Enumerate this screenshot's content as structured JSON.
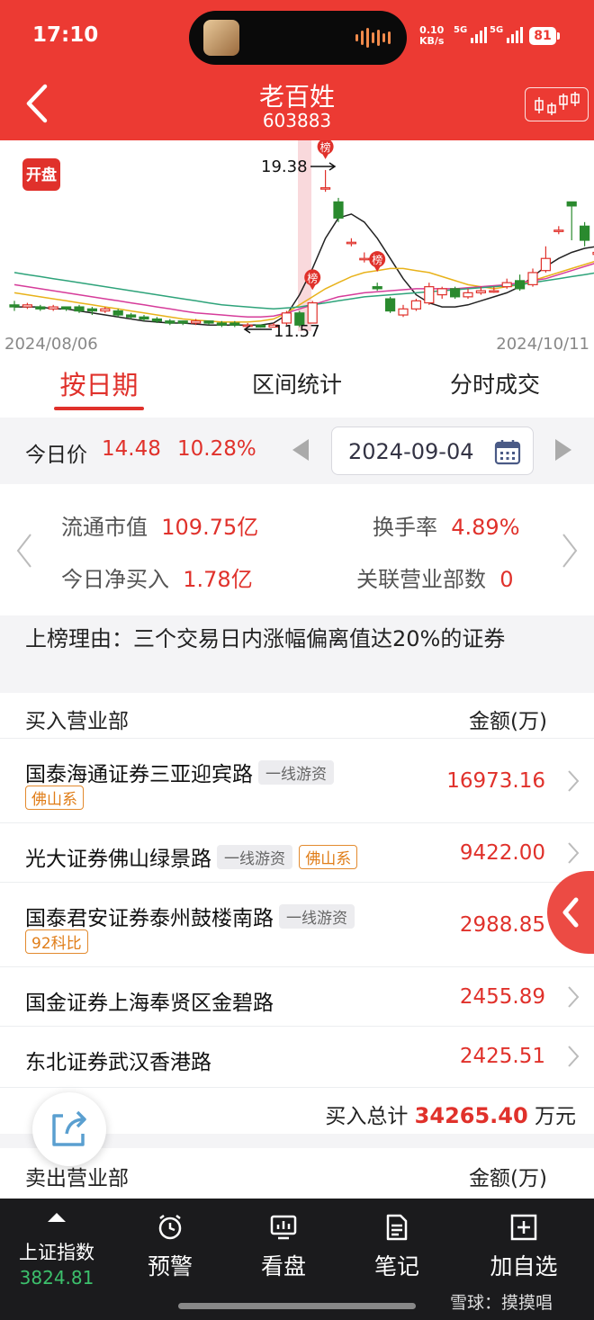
{
  "status_bar": {
    "time": "17:10",
    "net_speed_value": "0.10",
    "net_speed_unit": "KB/s",
    "signal1_label": "5G",
    "signal2_label": "5G",
    "battery": "81"
  },
  "header": {
    "stock_name": "老百姓",
    "stock_code": "603883",
    "back_icon": "chevron-left-icon",
    "kline_icon": "candlestick-icon"
  },
  "chart": {
    "badge_open": "开盘",
    "high_label": "19.38",
    "low_label": "11.57",
    "start_date": "2024/08/06",
    "end_date": "2024/10/11",
    "marker_text": "榜"
  },
  "chart_data": {
    "type": "candlestick",
    "x_start": "2024/08/06",
    "x_end": "2024/10/11",
    "high_marked": 19.38,
    "low_marked": 11.57,
    "candles": [
      {
        "o": 12.7,
        "c": 12.6,
        "h": 12.9,
        "l": 12.4
      },
      {
        "o": 12.6,
        "c": 12.7,
        "h": 12.8,
        "l": 12.5
      },
      {
        "o": 12.6,
        "c": 12.5,
        "h": 12.7,
        "l": 12.4
      },
      {
        "o": 12.5,
        "c": 12.6,
        "h": 12.7,
        "l": 12.4
      },
      {
        "o": 12.6,
        "c": 12.5,
        "h": 12.6,
        "l": 12.4
      },
      {
        "o": 12.6,
        "c": 12.4,
        "h": 12.7,
        "l": 12.3
      },
      {
        "o": 12.5,
        "c": 12.4,
        "h": 12.6,
        "l": 12.2
      },
      {
        "o": 12.4,
        "c": 12.5,
        "h": 12.6,
        "l": 12.3
      },
      {
        "o": 12.4,
        "c": 12.2,
        "h": 12.5,
        "l": 12.1
      },
      {
        "o": 12.2,
        "c": 12.1,
        "h": 12.3,
        "l": 12.0
      },
      {
        "o": 12.1,
        "c": 12.0,
        "h": 12.2,
        "l": 11.9
      },
      {
        "o": 12.0,
        "c": 11.9,
        "h": 12.1,
        "l": 11.8
      },
      {
        "o": 11.9,
        "c": 11.8,
        "h": 12.0,
        "l": 11.7
      },
      {
        "o": 11.9,
        "c": 11.8,
        "h": 11.9,
        "l": 11.7
      },
      {
        "o": 11.8,
        "c": 11.9,
        "h": 12.0,
        "l": 11.7
      },
      {
        "o": 11.9,
        "c": 11.8,
        "h": 11.9,
        "l": 11.7
      },
      {
        "o": 11.8,
        "c": 11.7,
        "h": 11.9,
        "l": 11.6
      },
      {
        "o": 11.8,
        "c": 11.7,
        "h": 11.9,
        "l": 11.6
      },
      {
        "o": 11.7,
        "c": 11.7,
        "h": 11.8,
        "l": 11.6
      },
      {
        "o": 11.7,
        "c": 11.6,
        "h": 11.7,
        "l": 11.57
      },
      {
        "o": 11.6,
        "c": 11.7,
        "h": 11.8,
        "l": 11.6
      },
      {
        "o": 11.8,
        "c": 12.3,
        "h": 12.4,
        "l": 11.7
      },
      {
        "o": 12.3,
        "c": 11.7,
        "h": 12.4,
        "l": 11.6
      },
      {
        "o": 11.8,
        "c": 12.8,
        "h": 12.9,
        "l": 11.8
      },
      {
        "o": 18.5,
        "c": 18.5,
        "h": 19.38,
        "l": 18.3
      },
      {
        "o": 17.8,
        "c": 17.0,
        "h": 18.0,
        "l": 16.8
      },
      {
        "o": 15.8,
        "c": 15.8,
        "h": 16.0,
        "l": 15.6
      },
      {
        "o": 15.0,
        "c": 15.0,
        "h": 15.3,
        "l": 14.8
      },
      {
        "o": 13.6,
        "c": 13.5,
        "h": 13.8,
        "l": 13.4
      },
      {
        "o": 13.0,
        "c": 12.4,
        "h": 13.1,
        "l": 12.3
      },
      {
        "o": 12.2,
        "c": 12.5,
        "h": 12.7,
        "l": 12.1
      },
      {
        "o": 12.5,
        "c": 12.9,
        "h": 13.0,
        "l": 12.4
      },
      {
        "o": 12.8,
        "c": 13.6,
        "h": 13.8,
        "l": 12.7
      },
      {
        "o": 13.2,
        "c": 13.5,
        "h": 13.6,
        "l": 13.0
      },
      {
        "o": 13.5,
        "c": 13.1,
        "h": 13.6,
        "l": 13.0
      },
      {
        "o": 13.1,
        "c": 13.3,
        "h": 13.5,
        "l": 13.0
      },
      {
        "o": 13.3,
        "c": 13.4,
        "h": 13.6,
        "l": 13.2
      },
      {
        "o": 13.4,
        "c": 13.4,
        "h": 13.6,
        "l": 13.3
      },
      {
        "o": 13.6,
        "c": 13.8,
        "h": 14.0,
        "l": 13.5
      },
      {
        "o": 13.9,
        "c": 13.5,
        "h": 14.2,
        "l": 13.4
      },
      {
        "o": 13.7,
        "c": 14.3,
        "h": 14.5,
        "l": 13.6
      },
      {
        "o": 14.4,
        "c": 15.0,
        "h": 15.6,
        "l": 14.3
      },
      {
        "o": 16.4,
        "c": 16.4,
        "h": 16.6,
        "l": 16.2
      },
      {
        "o": 17.8,
        "c": 17.6,
        "h": 17.8,
        "l": 15.9
      },
      {
        "o": 16.6,
        "c": 15.9,
        "h": 16.8,
        "l": 15.6
      },
      {
        "o": 15.2,
        "c": 15.3,
        "h": 15.5,
        "l": 14.8
      },
      {
        "o": 15.3,
        "c": 15.6,
        "h": 15.9,
        "l": 15.1
      }
    ],
    "series": [
      {
        "values": [
          12.6,
          12.6,
          12.6,
          12.5,
          12.5,
          12.4,
          12.3,
          12.2,
          12.1,
          12.0,
          11.9,
          11.85,
          11.8,
          11.8,
          11.75,
          11.7,
          11.7,
          11.7,
          11.7,
          11.7,
          11.8,
          12.2,
          13.2,
          14.5,
          16.0,
          17.0,
          17.2,
          16.8,
          16.0,
          15.0,
          14.0,
          13.2,
          12.8,
          12.6,
          12.6,
          12.7,
          12.9,
          13.1,
          13.3,
          13.6,
          14.1,
          14.6,
          15.0,
          15.3,
          15.5,
          15.6,
          15.7
        ],
        "color": "#222222"
      },
      {
        "values": [
          13.3,
          13.2,
          13.1,
          13.0,
          12.9,
          12.8,
          12.7,
          12.6,
          12.5,
          12.4,
          12.3,
          12.2,
          12.1,
          12.0,
          11.95,
          11.9,
          11.85,
          11.85,
          11.85,
          11.9,
          12.0,
          12.3,
          12.7,
          13.1,
          13.5,
          13.8,
          14.1,
          14.3,
          14.4,
          14.5,
          14.5,
          14.4,
          14.3,
          14.1,
          13.9,
          13.7,
          13.6,
          13.5,
          13.6,
          13.7,
          13.9,
          14.1,
          14.3,
          14.5,
          14.7,
          14.9,
          15.0
        ],
        "color": "#e8b21a"
      },
      {
        "values": [
          13.7,
          13.6,
          13.5,
          13.4,
          13.3,
          13.2,
          13.1,
          13.0,
          12.9,
          12.8,
          12.7,
          12.6,
          12.5,
          12.4,
          12.3,
          12.25,
          12.2,
          12.15,
          12.1,
          12.1,
          12.15,
          12.3,
          12.5,
          12.7,
          12.9,
          13.1,
          13.2,
          13.3,
          13.35,
          13.4,
          13.45,
          13.5,
          13.5,
          13.5,
          13.5,
          13.55,
          13.6,
          13.65,
          13.7,
          13.8,
          13.9,
          14.0,
          14.2,
          14.4,
          14.6,
          14.8,
          15.0
        ],
        "color": "#d63c9a"
      },
      {
        "values": [
          14.3,
          14.2,
          14.1,
          14.0,
          13.9,
          13.8,
          13.7,
          13.6,
          13.5,
          13.4,
          13.3,
          13.2,
          13.1,
          13.0,
          12.9,
          12.8,
          12.7,
          12.65,
          12.6,
          12.55,
          12.5,
          12.55,
          12.6,
          12.7,
          12.8,
          12.9,
          13.0,
          13.1,
          13.15,
          13.2,
          13.25,
          13.3,
          13.35,
          13.4,
          13.45,
          13.5,
          13.55,
          13.6,
          13.65,
          13.7,
          13.8,
          13.9,
          14.0,
          14.1,
          14.2,
          14.3,
          14.4
        ],
        "color": "#2ea37a"
      }
    ],
    "up_color": "#e0312b",
    "down_color": "#2a8a2e",
    "markers": [
      {
        "index": 23,
        "text": "榜"
      },
      {
        "index": 24,
        "text": "榜"
      },
      {
        "index": 28,
        "text": "榜"
      }
    ]
  },
  "tabs": [
    "按日期",
    "区间统计",
    "分时成交"
  ],
  "date_row": {
    "price_label": "今日价",
    "price": "14.48",
    "change_pct": "10.28%",
    "date": "2024-09-04"
  },
  "stats": {
    "float_cap_label": "流通市值",
    "float_cap_value": "109.75亿",
    "turnover_label": "换手率",
    "turnover_value": "4.89%",
    "net_buy_label": "今日净买入",
    "net_buy_value": "1.78亿",
    "branches_label": "关联营业部数",
    "branches_value": "0"
  },
  "reason": "上榜理由：三个交易日内涨幅偏离值达20%的证券",
  "buy": {
    "header_left": "买入营业部",
    "header_right": "金额(万)",
    "rows": [
      {
        "name": "国泰海通证券三亚迎宾路",
        "tag_gray": "一线游资",
        "tag_orange": "佛山系",
        "amount": "16973.16"
      },
      {
        "name": "光大证券佛山绿景路",
        "tag_gray": "一线游资",
        "tag_orange": "佛山系",
        "amount": "9422.00"
      },
      {
        "name": "国泰君安证券泰州鼓楼南路",
        "tag_gray": "一线游资",
        "tag_orange": "92科比",
        "amount": "2988.85"
      },
      {
        "name": "国金证券上海奉贤区金碧路",
        "amount": "2455.89"
      },
      {
        "name": "东北证券武汉香港路",
        "amount": "2425.51"
      }
    ],
    "total_label": "买入总计",
    "total_value": "34265.40",
    "total_unit": "万元"
  },
  "sell": {
    "header_left": "卖出营业部",
    "header_right": "金额(万)"
  },
  "bottom_nav": {
    "index_label": "上证指数",
    "index_value": "3824.81",
    "items": [
      "预警",
      "看盘",
      "笔记",
      "加自选"
    ]
  },
  "watermark": "雪球：摸摸唱"
}
